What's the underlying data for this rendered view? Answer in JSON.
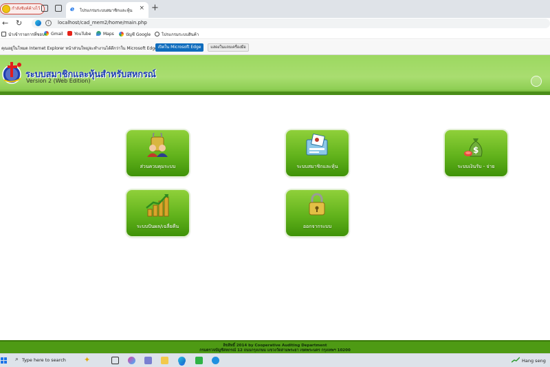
{
  "browser": {
    "profile_label": "กำลังซิงค์ค้างไว้",
    "tab_title": "โปรแกรมระบบสมาชิกและหุ้น",
    "url": "localhost/cad_mem2/home/main.php",
    "bookmarks": [
      {
        "label": "นำเข้ารายการที่ชอบ",
        "icon": "folder-icon"
      },
      {
        "label": "Gmail",
        "icon": "google-icon"
      },
      {
        "label": "YouTube",
        "icon": "youtube-icon"
      },
      {
        "label": "Maps",
        "icon": "maps-icon"
      },
      {
        "label": "บัญชี Google",
        "icon": "google-icon"
      },
      {
        "label": "โปรแกรมระบบสินค้า",
        "icon": "globe-icon"
      }
    ],
    "ie_banner": {
      "message": "คุณอยู่ในโหมด Internet Explorer หน้าส่วนใหญ่จะทำงานได้ดีกว่าใน Microsoft Edge",
      "primary_button": "เปิดใน Microsoft Edge",
      "secondary_button": "แสดงในแถบเครื่องมือ"
    }
  },
  "app": {
    "title": "ระบบสมาชิกและหุ้นสำหรับสหกรณ์",
    "subtitle": "Version 2 (Web Edition)",
    "menu": [
      {
        "label": "ส่วนควบคุมระบบ",
        "icon": "admin-user-icon"
      },
      {
        "label": "ระบบสมาชิกและหุ้น",
        "icon": "member-card-icon"
      },
      {
        "label": "ระบบเงินรับ - จ่าย",
        "icon": "money-bag-icon"
      },
      {
        "label": "ระบบปันผล/เฉลี่ยคืน",
        "icon": "dividend-chart-icon"
      },
      {
        "label": "ออกจากระบบ",
        "icon": "padlock-icon"
      }
    ],
    "footer_line1": "ลิขสิทธิ์ 2014 by Cooperative Auditing Department",
    "footer_line2": "กรมตรวจบัญชีสหกรณ์ 12 ถนนกรุงเกษม แขวงวัดสามพระยา เขตพระนคร กรุงเทพฯ 10200",
    "accent_color": "#62b31c"
  },
  "taskbar": {
    "search_placeholder": "Type here to search",
    "weather": "Hang seng"
  }
}
